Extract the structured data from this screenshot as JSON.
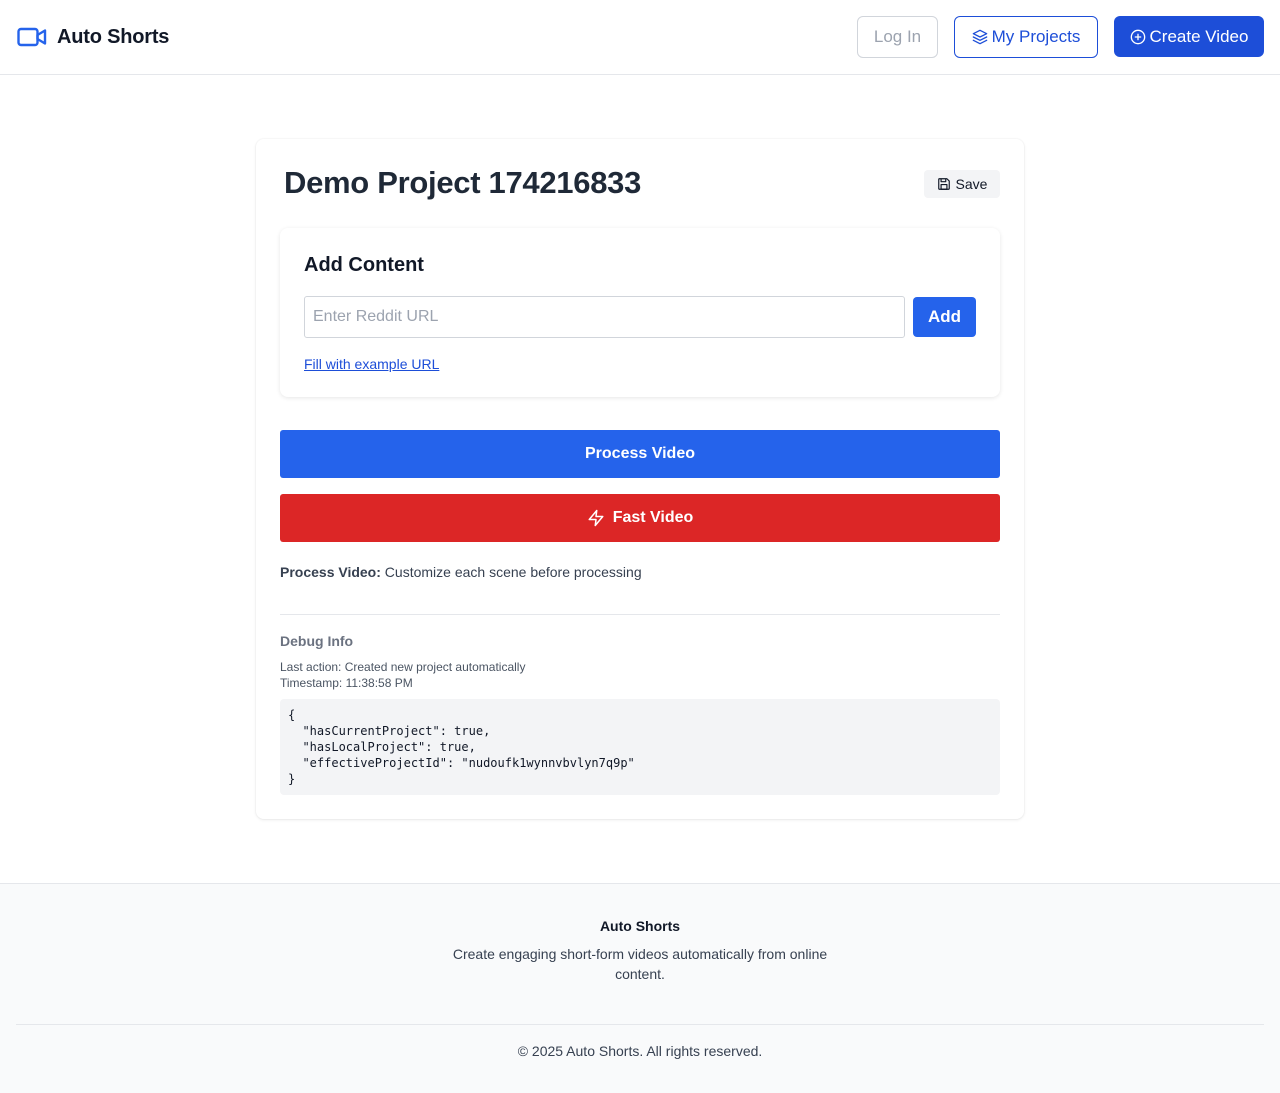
{
  "app": {
    "name": "Auto Shorts",
    "logo_icon": "video-camera-icon",
    "brand_color": "#2563eb"
  },
  "header": {
    "login_label": "Log In",
    "my_projects_label": "My Projects",
    "my_projects_icon": "layers-icon",
    "create_video_label": "Create Video",
    "create_video_icon": "plus-circle-icon"
  },
  "project": {
    "title": "Demo Project 174216833",
    "save_label": "Save",
    "save_icon": "floppy-disk-icon"
  },
  "add_content": {
    "title": "Add Content",
    "url_placeholder": "Enter Reddit URL",
    "url_value": "",
    "add_label": "Add",
    "example_link": "Fill with example URL"
  },
  "actions": {
    "process_label": "Process Video",
    "fast_label": "Fast Video",
    "fast_icon": "lightning-icon",
    "process_color": "#2563eb",
    "fast_color": "#dc2626",
    "note_label": "Process Video:",
    "note_text": "Customize each scene before processing"
  },
  "debug": {
    "title": "Debug Info",
    "last_action": "Last action: Created new project automatically",
    "timestamp": "Timestamp: 11:38:58 PM",
    "code": "{\n  \"hasCurrentProject\": true,\n  \"hasLocalProject\": true,\n  \"effectiveProjectId\": \"nudoufk1wynnvbvlyn7q9p\"\n}"
  },
  "footer": {
    "title": "Auto Shorts",
    "description": "Create engaging short-form videos automatically from online content.",
    "copyright": "© 2025 Auto Shorts. All rights reserved."
  }
}
